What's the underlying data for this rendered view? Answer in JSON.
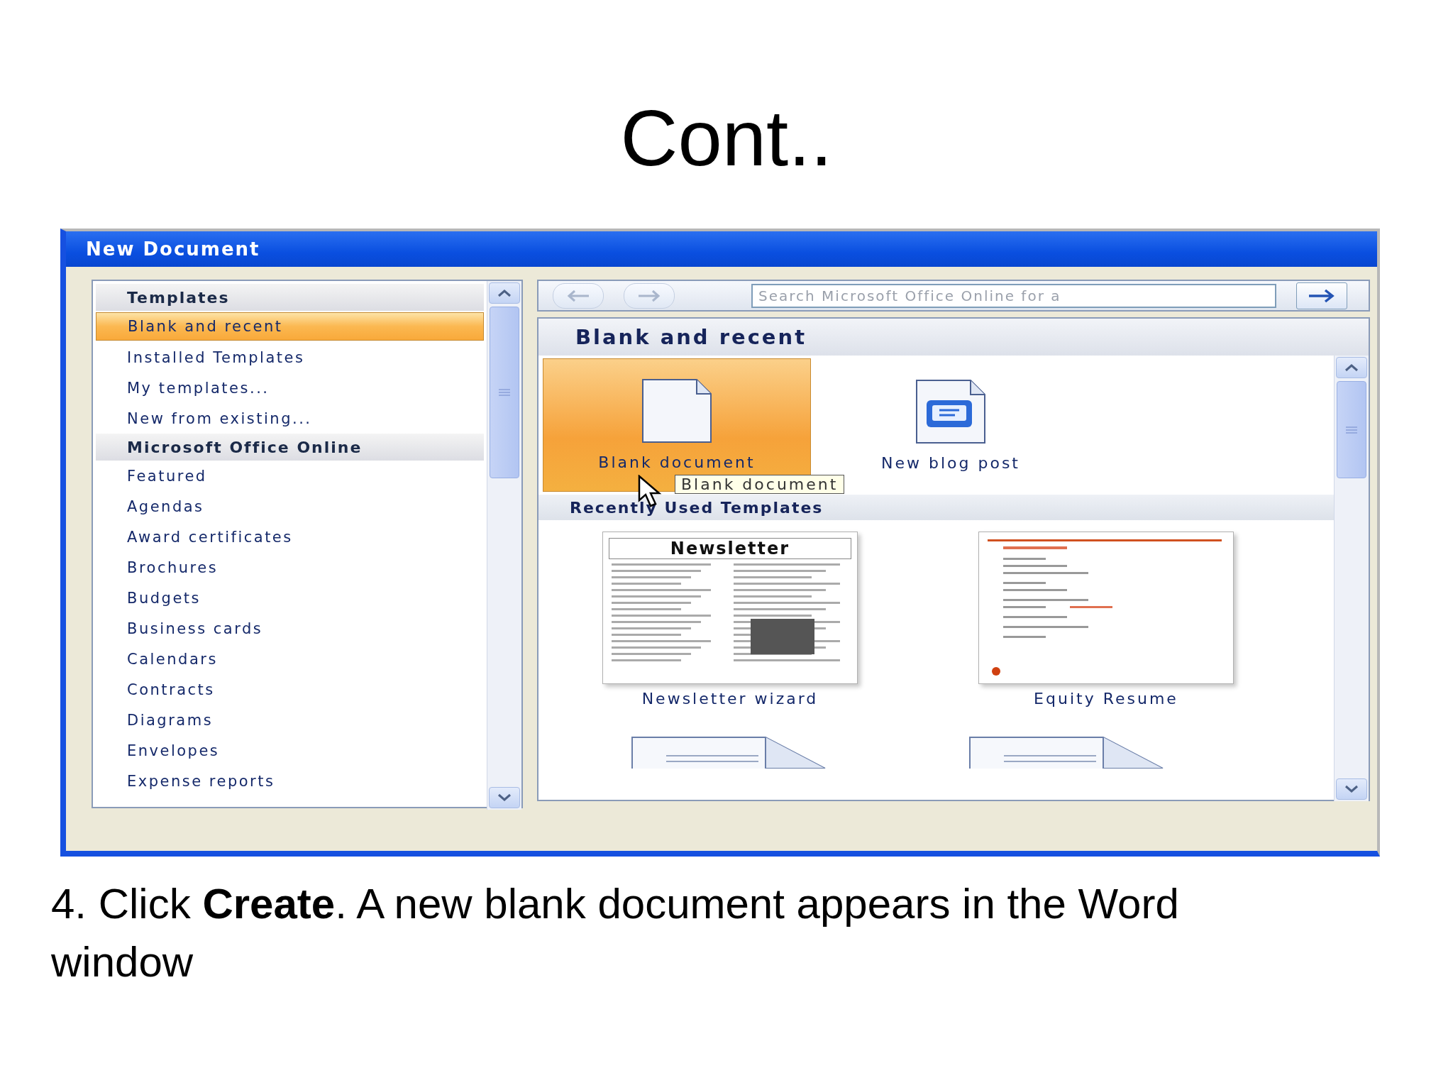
{
  "slide": {
    "title": "Cont..",
    "caption": "4.  Click **Create**. A new blank document appears in the Word window"
  },
  "window": {
    "title": "New Document"
  },
  "sidebar": {
    "sections": [
      {
        "heading": "Templates",
        "items": [
          {
            "label": "Blank and recent",
            "selected": true
          },
          {
            "label": "Installed Templates",
            "selected": false
          },
          {
            "label": "My templates...",
            "selected": false
          },
          {
            "label": "New from existing...",
            "selected": false
          }
        ]
      },
      {
        "heading": "Microsoft Office Online",
        "items": [
          {
            "label": "Featured",
            "selected": false
          },
          {
            "label": "Agendas",
            "selected": false
          },
          {
            "label": "Award certificates",
            "selected": false
          },
          {
            "label": "Brochures",
            "selected": false
          },
          {
            "label": "Budgets",
            "selected": false
          },
          {
            "label": "Business cards",
            "selected": false
          },
          {
            "label": "Calendars",
            "selected": false
          },
          {
            "label": "Contracts",
            "selected": false
          },
          {
            "label": "Diagrams",
            "selected": false
          },
          {
            "label": "Envelopes",
            "selected": false
          },
          {
            "label": "Expense reports",
            "selected": false
          }
        ]
      }
    ]
  },
  "search": {
    "placeholder": "Search Microsoft Office Online for a"
  },
  "gallery": {
    "title": "Blank and recent",
    "tiles": [
      {
        "kind": "blank",
        "label": "Blank document",
        "selected": true
      },
      {
        "kind": "blog",
        "label": "New blog post",
        "selected": false
      }
    ],
    "tooltip": "Blank document",
    "recent_heading": "Recently Used Templates",
    "recent": [
      {
        "kind": "newsletter",
        "heading": "Newsletter",
        "label": "Newsletter wizard"
      },
      {
        "kind": "resume",
        "label": "Equity Resume"
      }
    ]
  }
}
